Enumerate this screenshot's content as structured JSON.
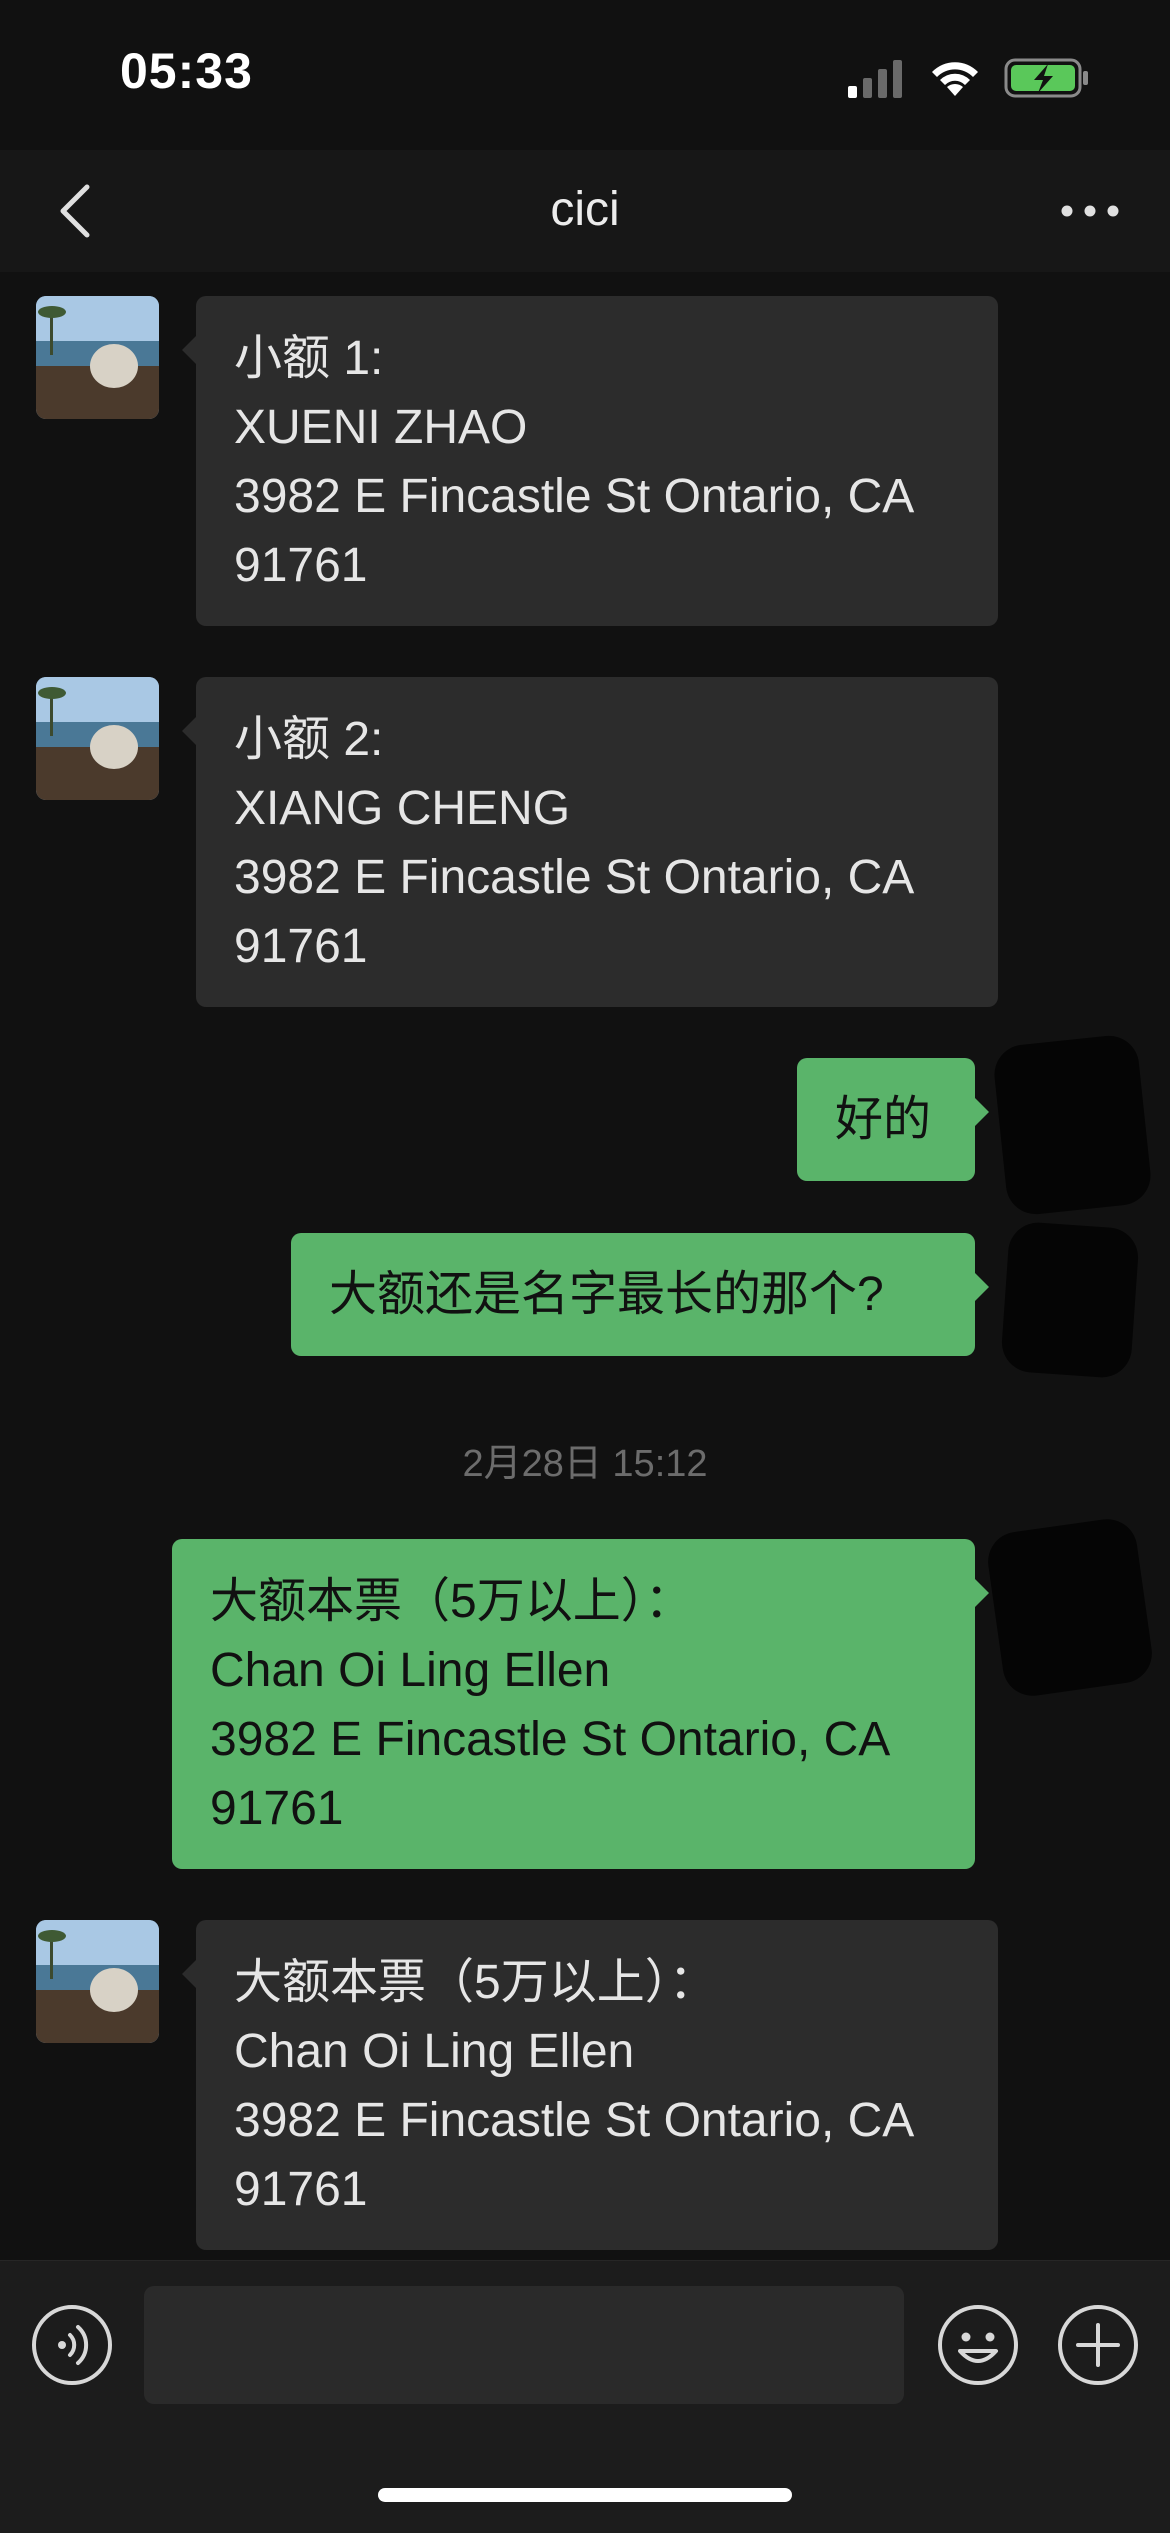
{
  "status_bar": {
    "time": "05:33",
    "icons": [
      "cellular-signal-icon",
      "wifi-icon",
      "battery-charging-icon"
    ]
  },
  "nav": {
    "back_icon": "chevron-left-icon",
    "title": "cici",
    "more_icon": "ellipsis-icon"
  },
  "messages": [
    {
      "direction": "incoming",
      "lines": [
        "小额 1:",
        "XUENI ZHAO",
        "3982 E Fincastle St Ontario, CA",
        "91761"
      ]
    },
    {
      "direction": "incoming",
      "lines": [
        "小额 2:",
        "XIANG CHENG",
        "3982 E Fincastle St Ontario, CA",
        "91761"
      ]
    },
    {
      "direction": "outgoing",
      "lines": [
        "好的"
      ]
    },
    {
      "direction": "outgoing",
      "lines": [
        "大额还是名字最长的那个?"
      ]
    },
    {
      "direction": "outgoing",
      "lines": [
        "大额本票（5万以上）：",
        "Chan Oi Ling Ellen",
        "3982 E Fincastle St Ontario, CA",
        "91761"
      ]
    },
    {
      "direction": "incoming",
      "lines": [
        "大额本票（5万以上）：",
        "Chan Oi Ling Ellen",
        "3982 E Fincastle St Ontario, CA",
        "91761"
      ]
    }
  ],
  "timestamp": "2月28日 15:12",
  "input_bar": {
    "voice_icon": "voice-icon",
    "text_value": "",
    "emoji_icon": "emoji-icon",
    "plus_icon": "plus-icon"
  },
  "colors": {
    "background": "#111111",
    "incoming_bubble": "#2c2c2c",
    "outgoing_bubble": "#5ab46a"
  }
}
